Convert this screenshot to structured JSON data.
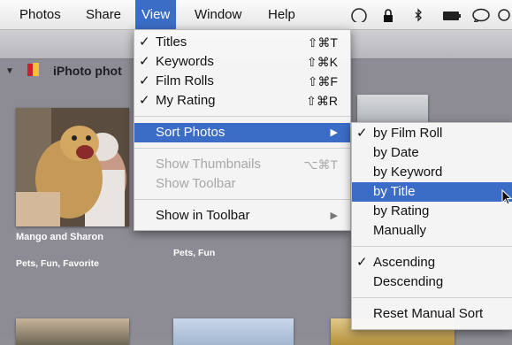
{
  "menubar": {
    "items": [
      {
        "label": "Photos"
      },
      {
        "label": "Share"
      },
      {
        "label": "View"
      },
      {
        "label": "Window"
      },
      {
        "label": "Help"
      }
    ],
    "active": "View",
    "tray_icons": [
      "sync-circle-icon",
      "lock-icon",
      "bluetooth-icon",
      "battery-icon",
      "chat-bubble-icon",
      "search-icon"
    ]
  },
  "album": {
    "title": "iPhoto phot",
    "photos": [
      {
        "title": "Mango and Sharon",
        "keywords": "Pets, Fun, Favorite"
      },
      {
        "title": "",
        "keywords": "Pets, Fun"
      }
    ]
  },
  "view_menu": {
    "items": [
      {
        "label": "Titles",
        "checked": true,
        "shortcut": "⇧⌘T"
      },
      {
        "label": "Keywords",
        "checked": true,
        "shortcut": "⇧⌘K"
      },
      {
        "label": "Film Rolls",
        "checked": true,
        "shortcut": "⇧⌘F"
      },
      {
        "label": "My Rating",
        "checked": true,
        "shortcut": "⇧⌘R"
      },
      {
        "label": "Sort Photos",
        "highlighted": true,
        "submenu": true
      },
      {
        "label": "Show Thumbnails",
        "disabled": true,
        "shortcut": "⌥⌘T"
      },
      {
        "label": "Show Toolbar",
        "disabled": true
      },
      {
        "label": "Show in Toolbar",
        "submenu": true
      }
    ],
    "check_glyph": "✓",
    "submenu_glyph": "▶"
  },
  "sort_menu": {
    "items": [
      {
        "label": "by Film Roll",
        "checked": true
      },
      {
        "label": "by Date"
      },
      {
        "label": "by Keyword"
      },
      {
        "label": "by Title",
        "highlighted": true
      },
      {
        "label": "by Rating"
      },
      {
        "label": "Manually"
      },
      {
        "label": "Ascending",
        "checked": true
      },
      {
        "label": "Descending"
      },
      {
        "label": "Reset Manual Sort"
      }
    ]
  },
  "colors": {
    "highlight": "#3b6cc6",
    "menubar": "#f2f2f2",
    "photo_pane": "#8d8b93"
  }
}
